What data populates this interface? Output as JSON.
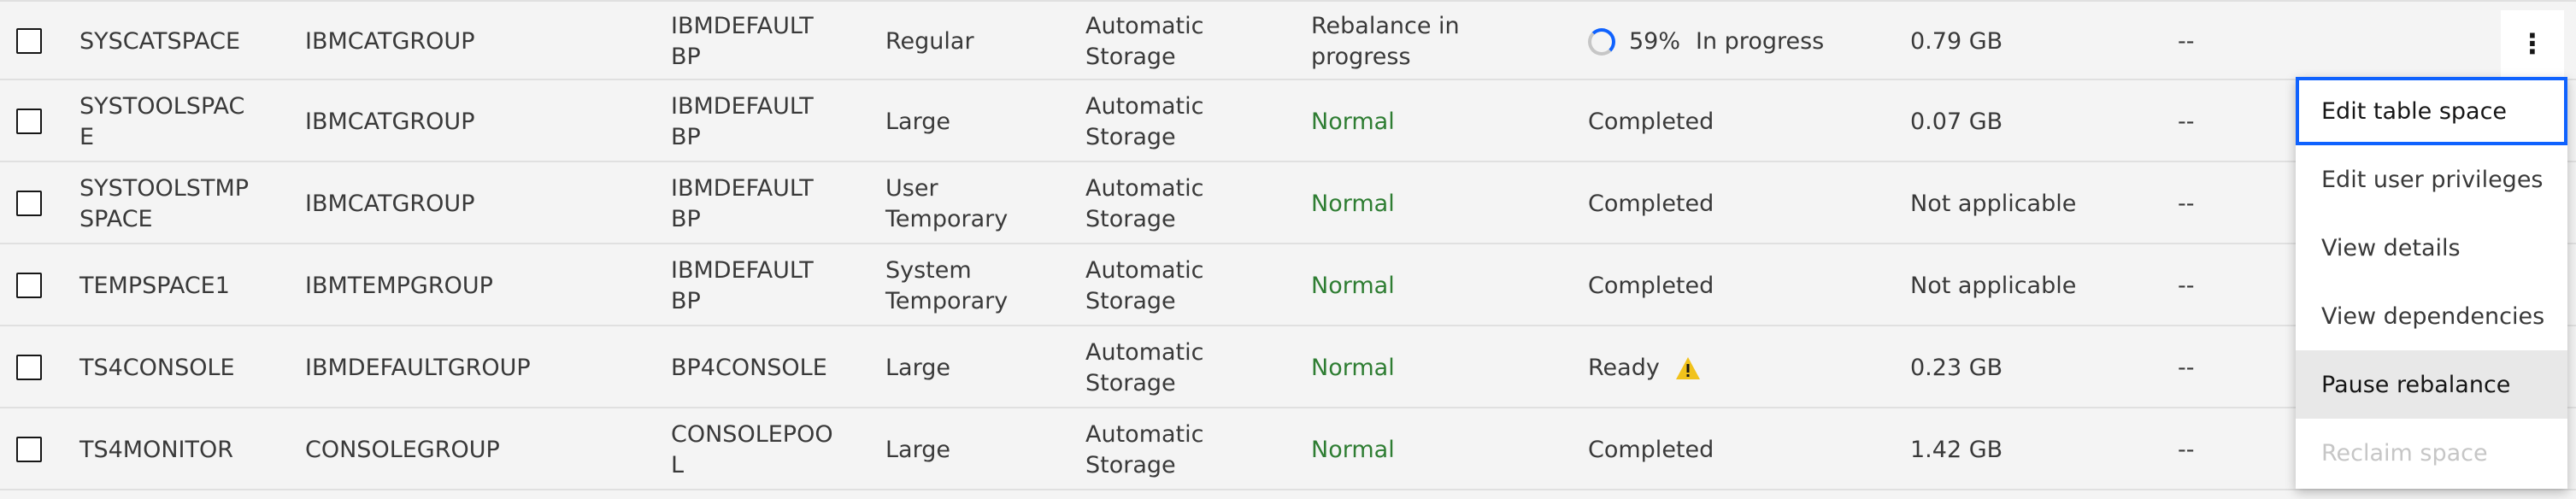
{
  "rows": [
    {
      "name": "SYSCATSPACE",
      "group": "IBMCATGROUP",
      "bufferpool": "IBMDEFAULT\nBP",
      "type": "Regular",
      "management": "Automatic\nStorage",
      "status": "Rebalance in\nprogress",
      "operation": "In progress",
      "progress_percent": "59%",
      "used": "0.79 GB",
      "extra": "--"
    },
    {
      "name": "SYSTOOLSPAC\nE",
      "group": "IBMCATGROUP",
      "bufferpool": "IBMDEFAULT\nBP",
      "type": "Large",
      "management": "Automatic\nStorage",
      "status": "Normal",
      "operation": "Completed",
      "used": "0.07 GB",
      "extra": "--"
    },
    {
      "name": "SYSTOOLSTMP\nSPACE",
      "group": "IBMCATGROUP",
      "bufferpool": "IBMDEFAULT\nBP",
      "type": "User\nTemporary",
      "management": "Automatic\nStorage",
      "status": "Normal",
      "operation": "Completed",
      "used": "Not applicable",
      "extra": "--"
    },
    {
      "name": "TEMPSPACE1",
      "group": "IBMTEMPGROUP",
      "bufferpool": "IBMDEFAULT\nBP",
      "type": "System\nTemporary",
      "management": "Automatic\nStorage",
      "status": "Normal",
      "operation": "Completed",
      "used": "Not applicable",
      "extra": "--"
    },
    {
      "name": "TS4CONSOLE",
      "group": "IBMDEFAULTGROUP",
      "bufferpool": "BP4CONSOLE",
      "type": "Large",
      "management": "Automatic\nStorage",
      "status": "Normal",
      "operation": "Ready",
      "used": "0.23 GB",
      "extra": "--"
    },
    {
      "name": "TS4MONITOR",
      "group": "CONSOLEGROUP",
      "bufferpool": "CONSOLEPOO\nL",
      "type": "Large",
      "management": "Automatic\nStorage",
      "status": "Normal",
      "operation": "Completed",
      "used": "1.42 GB",
      "extra": "--"
    }
  ],
  "overflow_menu": {
    "button_glyph": "⋮",
    "items": [
      "Edit table space",
      "Edit user privileges",
      "View details",
      "View dependencies",
      "Pause rebalance",
      "Reclaim space"
    ]
  },
  "colors": {
    "normal_status": "#2e7d32",
    "focus_border": "#0f62fe",
    "warning": "#f1c21b"
  },
  "icons": {
    "progress": "spinner-icon",
    "warning": "warning-triangle-icon",
    "overflow": "overflow-menu-vertical-icon"
  }
}
